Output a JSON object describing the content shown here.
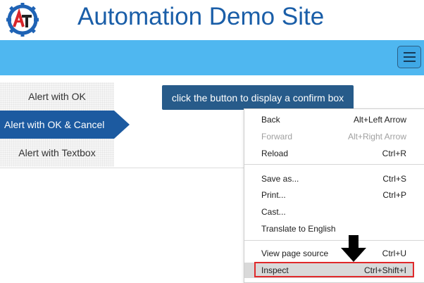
{
  "header": {
    "title": "Automation Demo Site",
    "logo_icon": "gear-logo-icon",
    "logo_text": "AT"
  },
  "navbar": {
    "color": "#4fb7f0",
    "menu_icon": "hamburger-icon"
  },
  "tabs": [
    {
      "label": "Alert with OK",
      "active": false
    },
    {
      "label": "Alert with OK & Cancel",
      "active": true
    },
    {
      "label": "Alert with Textbox",
      "active": false
    }
  ],
  "main": {
    "button_label": "click the button to display a confirm box"
  },
  "context_menu": {
    "items": [
      {
        "label": "Back",
        "shortcut": "Alt+Left Arrow",
        "disabled": false
      },
      {
        "label": "Forward",
        "shortcut": "Alt+Right Arrow",
        "disabled": true
      },
      {
        "label": "Reload",
        "shortcut": "Ctrl+R",
        "disabled": false
      },
      {
        "label": "Save as...",
        "shortcut": "Ctrl+S",
        "disabled": false
      },
      {
        "label": "Print...",
        "shortcut": "Ctrl+P",
        "disabled": false
      },
      {
        "label": "Cast...",
        "shortcut": "",
        "disabled": false
      },
      {
        "label": "Translate to English",
        "shortcut": "",
        "disabled": false
      },
      {
        "label": "View page source",
        "shortcut": "Ctrl+U",
        "disabled": false
      },
      {
        "label": "Inspect",
        "shortcut": "Ctrl+Shift+I",
        "disabled": false,
        "highlighted": true
      }
    ]
  },
  "annotations": {
    "highlight_color": "#e0292b",
    "arrow_icon": "down-arrow-icon"
  }
}
